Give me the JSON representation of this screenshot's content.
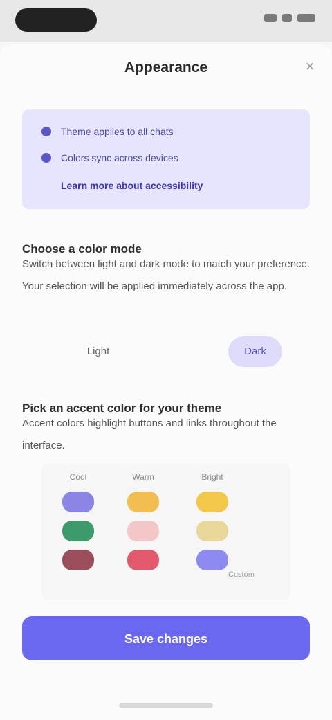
{
  "status_bar": {
    "time": "",
    "battery": ""
  },
  "sheet": {
    "title": "Appearance"
  },
  "info_card": {
    "items": [
      {
        "label": "Theme applies to all chats"
      },
      {
        "label": "Colors sync across devices"
      }
    ],
    "link_label": "Learn more about accessibility"
  },
  "section1": {
    "title": "Choose a color mode",
    "body": "Switch between light and dark mode to match your preference. Your selection will be applied immediately across the app."
  },
  "mode_toggle": {
    "left_label": "Light",
    "right_label": "Dark",
    "selected": "Dark"
  },
  "section2": {
    "title": "Pick an accent color for your theme",
    "body": "Accent colors highlight buttons and links throughout the interface."
  },
  "swatches": {
    "columns": [
      {
        "head": "Cool",
        "colors": [
          "#8b86e6",
          "#3c9a6b",
          "#9a4d5a"
        ]
      },
      {
        "head": "Warm",
        "colors": [
          "#f2be52",
          "#f3c7c7",
          "#e35a6e"
        ]
      },
      {
        "head": "Bright",
        "colors": [
          "#f2c84b",
          "#e9d79a",
          "#8f8af2"
        ]
      }
    ],
    "note": "Custom"
  },
  "primary_button": {
    "label": "Save changes"
  },
  "colors": {
    "accent": "#6b68f0",
    "card_bg": "#e7e5fd"
  }
}
